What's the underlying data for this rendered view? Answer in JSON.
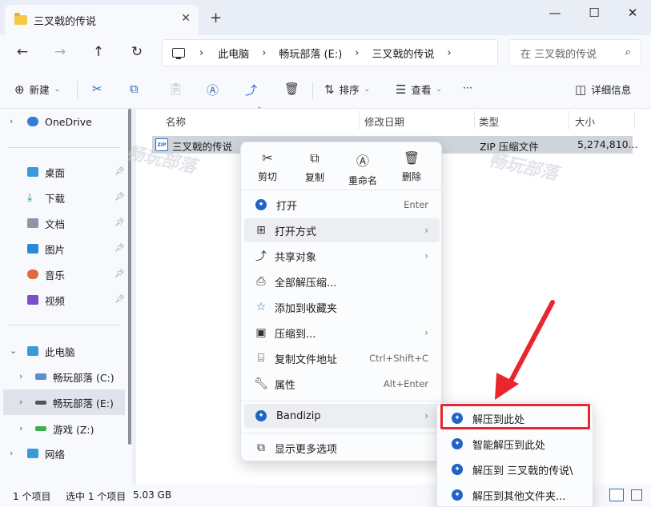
{
  "tab": {
    "title": "三叉戟的传说",
    "close": "✕",
    "new": "+"
  },
  "window": {
    "minimize": "—",
    "maximize": "☐",
    "close": "✕"
  },
  "nav": {
    "back": "←",
    "forward": "→",
    "up": "↑",
    "refresh": "↻"
  },
  "breadcrumb": {
    "sep": "›",
    "items": [
      "此电脑",
      "畅玩部落 (E:)",
      "三叉戟的传说"
    ]
  },
  "search": {
    "placeholder": "在 三叉戟的传说",
    "icon": "⌕"
  },
  "toolbar": {
    "new_label": "新建",
    "sort_label": "排序",
    "view_label": "查看",
    "details_label": "详细信息",
    "more": "···"
  },
  "sidebar": {
    "onedrive": "OneDrive",
    "quick": [
      "桌面",
      "下载",
      "文档",
      "图片",
      "音乐",
      "视频"
    ],
    "pc": "此电脑",
    "drives": [
      "畅玩部落 (C:)",
      "畅玩部落 (E:)",
      "游戏 (Z:)"
    ],
    "network": "网络"
  },
  "columns": {
    "name": "名称",
    "modified": "修改日期",
    "type": "类型",
    "size": "大小"
  },
  "file": {
    "name": "三叉戟的传说",
    "type": "ZIP 压缩文件",
    "size": "5,274,810...",
    "icon_text": "ZIP"
  },
  "watermark": "畅玩部落",
  "status": {
    "count": "1 个项目",
    "selected": "选中 1 个项目",
    "size": "5.03 GB"
  },
  "context_menu": {
    "top": [
      "剪切",
      "复制",
      "重命名",
      "删除"
    ],
    "items": [
      {
        "label": "打开",
        "shortcut": "Enter"
      },
      {
        "label": "打开方式",
        "shortcut": ""
      },
      {
        "label": "共享对象",
        "shortcut": ""
      },
      {
        "label": "全部解压缩...",
        "shortcut": ""
      },
      {
        "label": "添加到收藏夹",
        "shortcut": ""
      },
      {
        "label": "压缩到...",
        "shortcut": ""
      },
      {
        "label": "复制文件地址",
        "shortcut": "Ctrl+Shift+C"
      },
      {
        "label": "属性",
        "shortcut": "Alt+Enter"
      }
    ],
    "bandizip": "Bandizip",
    "more_options": "显示更多选项"
  },
  "submenu": [
    "解压到此处",
    "智能解压到此处",
    "解压到 三叉戟的传说\\",
    "解压到其他文件夹..."
  ],
  "colors": {
    "highlight": "#e8262e",
    "accent": "#1f63c6",
    "selection": "#cfd3da"
  }
}
